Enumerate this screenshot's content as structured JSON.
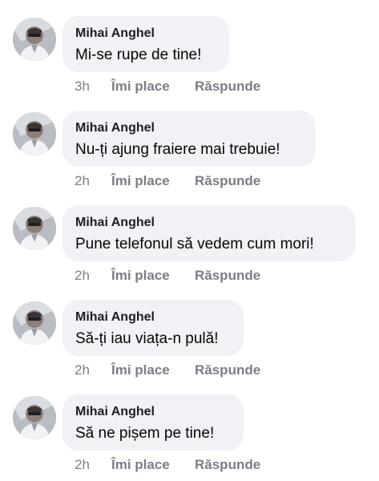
{
  "comments": [
    {
      "author": "Mihai Anghel",
      "text": "Mi-se rupe de tine!",
      "time": "3h",
      "like_label": "Îmi place",
      "reply_label": "Răspunde"
    },
    {
      "author": "Mihai Anghel",
      "text": "Nu-ți ajung fraiere mai trebuie!",
      "time": "2h",
      "like_label": "Îmi place",
      "reply_label": "Răspunde"
    },
    {
      "author": "Mihai Anghel",
      "text": "Pune telefonul să vedem cum mori!",
      "time": "2h",
      "like_label": "Îmi place",
      "reply_label": "Răspunde"
    },
    {
      "author": "Mihai Anghel",
      "text": "Să-ți iau viața-n pulă!",
      "time": "2h",
      "like_label": "Îmi place",
      "reply_label": "Răspunde"
    },
    {
      "author": "Mihai Anghel",
      "text": "Să ne pișem pe tine!",
      "time": "2h",
      "like_label": "Îmi place",
      "reply_label": "Răspunde"
    }
  ],
  "colors": {
    "bubble_background": "#f0f2f5",
    "author_text": "#1c1e21",
    "comment_text": "#050505",
    "meta_text": "#7b7e84"
  },
  "icons": {
    "avatar": "profile-photo-avatar"
  }
}
